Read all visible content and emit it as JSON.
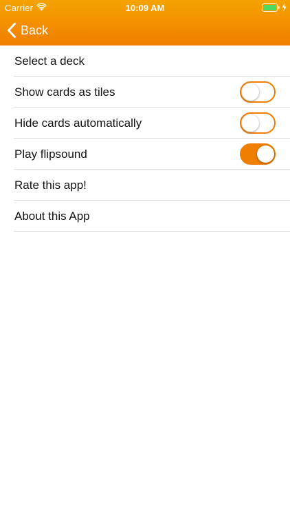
{
  "status_bar": {
    "carrier": "Carrier",
    "time": "10:09 AM",
    "wifi_icon": "wifi-icon",
    "battery_icon": "battery-icon",
    "battery_level": 1.0,
    "battery_color": "#4cd964"
  },
  "nav": {
    "back_label": "Back",
    "back_icon": "chevron-left-icon",
    "gradient_top": "#f5a300",
    "gradient_bottom": "#f07e00"
  },
  "settings": {
    "items": [
      {
        "label": "Select a deck"
      },
      {
        "label": "Show cards as tiles",
        "toggle": false
      },
      {
        "label": "Hide cards automatically",
        "toggle": false
      },
      {
        "label": "Play flipsound",
        "toggle": true
      },
      {
        "label": "Rate this app!"
      },
      {
        "label": "About this App"
      }
    ],
    "accent_color": "#f07e00"
  }
}
